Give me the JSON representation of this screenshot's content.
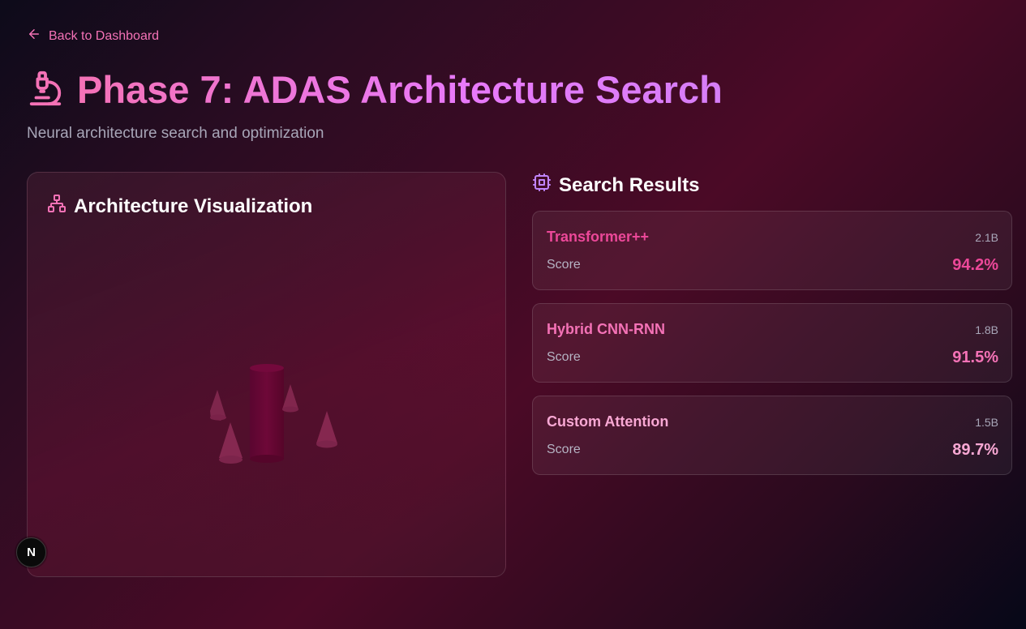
{
  "nav": {
    "back_label": "Back to Dashboard"
  },
  "header": {
    "title": "Phase 7: ADAS Architecture Search",
    "subtitle": "Neural architecture search and optimization"
  },
  "visualization": {
    "title": "Architecture Visualization"
  },
  "results": {
    "title": "Search Results",
    "items": [
      {
        "name": "Transformer++",
        "params": "2.1B",
        "score_label": "Score",
        "score": "94.2%",
        "color": "#ec4899"
      },
      {
        "name": "Hybrid CNN-RNN",
        "params": "1.8B",
        "score_label": "Score",
        "score": "91.5%",
        "color": "#f472b6"
      },
      {
        "name": "Custom Attention",
        "params": "1.5B",
        "score_label": "Score",
        "score": "89.7%",
        "color": "#f9a8d4"
      }
    ]
  },
  "badge": {
    "label": "N"
  },
  "colors": {
    "accent": "#f472b6",
    "accent_purple": "#e879f9"
  }
}
